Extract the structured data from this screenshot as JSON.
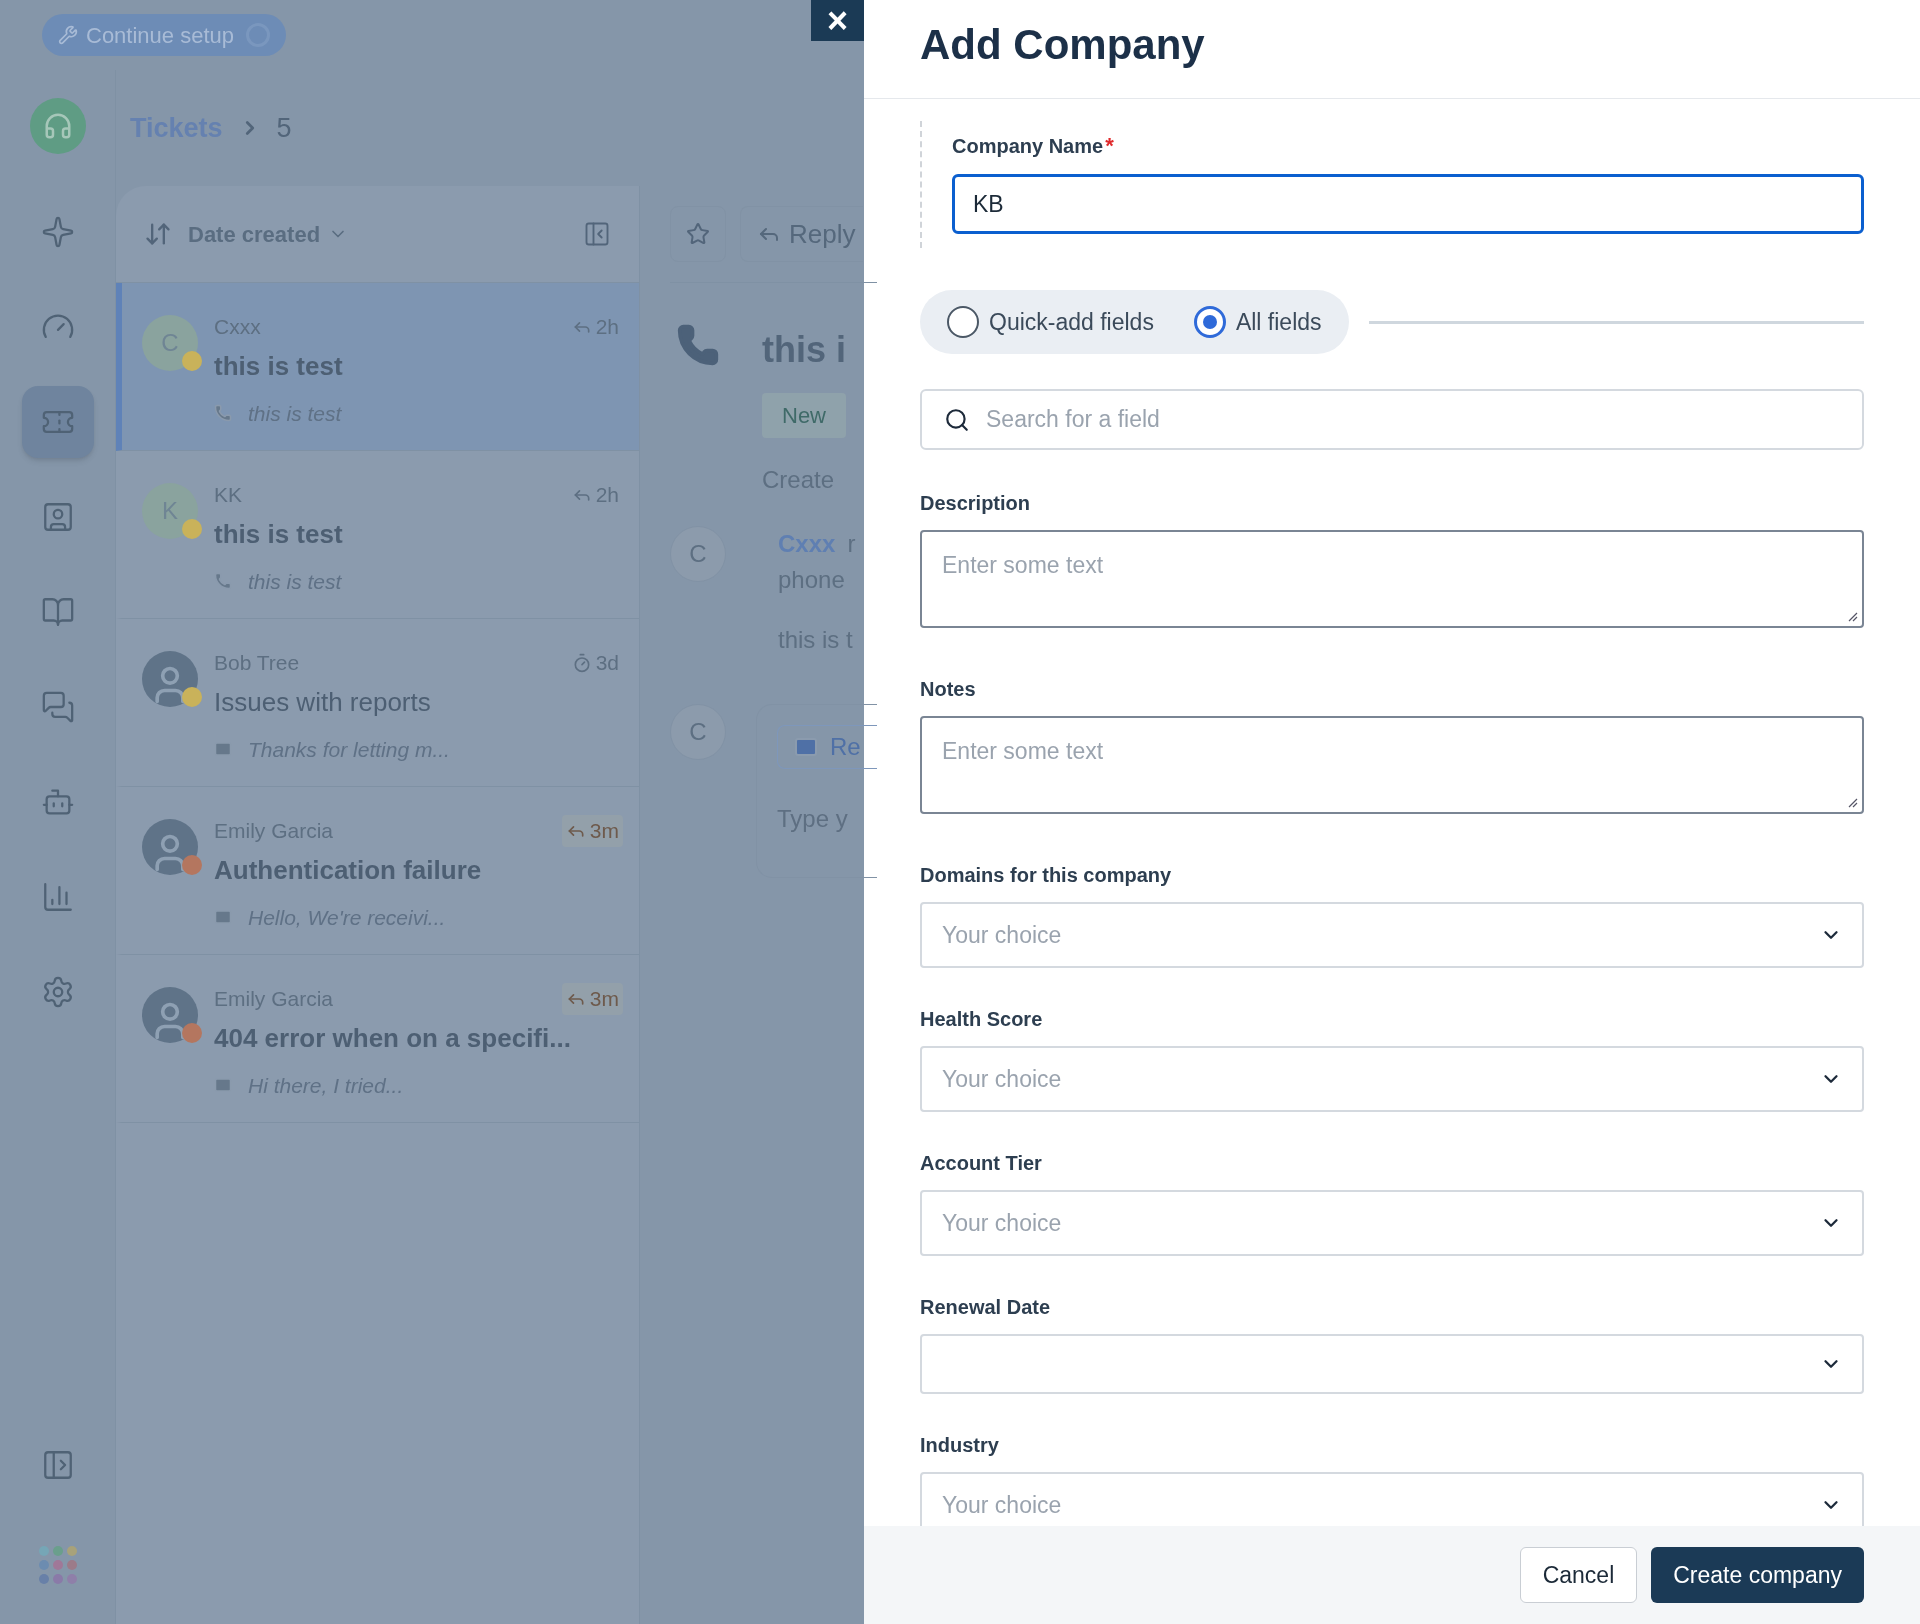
{
  "setup_button": {
    "label": "Continue setup"
  },
  "breadcrumb": {
    "parent": "Tickets",
    "current": "5"
  },
  "sidebar": {
    "items": [
      {
        "kind": "sparkle",
        "selected": false
      },
      {
        "kind": "gauge",
        "selected": false
      },
      {
        "kind": "ticket",
        "selected": true
      },
      {
        "kind": "contact",
        "selected": false
      },
      {
        "kind": "book",
        "selected": false
      },
      {
        "kind": "chat",
        "selected": false
      },
      {
        "kind": "bot",
        "selected": false
      },
      {
        "kind": "chart",
        "selected": false
      },
      {
        "kind": "settings",
        "selected": false
      }
    ]
  },
  "list_toolbar": {
    "sort_label": "Date created"
  },
  "tickets": [
    {
      "kind": "phone",
      "requester": "Cxxx",
      "initial": "C",
      "color": "#c9b25a",
      "time": {
        "kind": "reply",
        "text": "2h",
        "overdue": false
      },
      "subject": "this is test",
      "unread": true,
      "preview": "this is test",
      "selected": true
    },
    {
      "kind": "phone",
      "requester": "KK",
      "initial": "K",
      "color": "#c9b25a",
      "time": {
        "kind": "reply",
        "text": "2h",
        "overdue": false
      },
      "subject": "this is test",
      "unread": true,
      "preview": "this is test",
      "selected": false
    },
    {
      "kind": "email",
      "requester": "Bob Tree",
      "color": "#c9b25a",
      "time": {
        "kind": "timer",
        "text": "3d",
        "overdue": false
      },
      "subject": "Issues with reports",
      "unread": false,
      "preview": "Thanks for letting m...",
      "selected": false
    },
    {
      "kind": "email",
      "requester": "Emily Garcia",
      "color": "#b4765f",
      "time": {
        "kind": "reply",
        "text": "3m",
        "overdue": true
      },
      "subject": "Authentication failure",
      "unread": true,
      "preview": "Hello, We're receivi...",
      "selected": false
    },
    {
      "kind": "email",
      "requester": "Emily Garcia",
      "color": "#b4765f",
      "time": {
        "kind": "reply",
        "text": "3m",
        "overdue": true
      },
      "subject": "404 error when on a specifi...",
      "unread": true,
      "preview": "Hi there, I tried...",
      "selected": false
    }
  ],
  "detail": {
    "reply_button": "Reply",
    "title": "this i",
    "status": "New",
    "created": "Create",
    "author_initial": "C",
    "author": "Cxxx",
    "author_rest": "r",
    "author_line2": "phone",
    "body": "this is t",
    "reply_initial": "C",
    "reply_tab": "Re",
    "composer_placeholder": "Type y"
  },
  "drawer": {
    "close": "×",
    "title": "Add Company",
    "company_name": {
      "label": "Company Name",
      "required_marker": "*",
      "value": "KB"
    },
    "modes": [
      {
        "label": "Quick-add fields",
        "selected": false
      },
      {
        "label": "All fields",
        "selected": true
      }
    ],
    "search": {
      "placeholder": "Search for a field"
    },
    "fields": [
      {
        "kind": "textarea",
        "label": "Description",
        "placeholder": "Enter some text"
      },
      {
        "kind": "textarea",
        "label": "Notes",
        "placeholder": "Enter some text"
      },
      {
        "kind": "select",
        "label": "Domains for this company",
        "placeholder": "Your choice"
      },
      {
        "kind": "select",
        "label": "Health Score",
        "placeholder": "Your choice"
      },
      {
        "kind": "select",
        "label": "Account Tier",
        "placeholder": "Your choice"
      },
      {
        "kind": "date",
        "label": "Renewal Date"
      },
      {
        "kind": "select",
        "label": "Industry",
        "placeholder": "Your choice"
      }
    ],
    "buttons": {
      "cancel": "Cancel",
      "submit": "Create company"
    }
  }
}
